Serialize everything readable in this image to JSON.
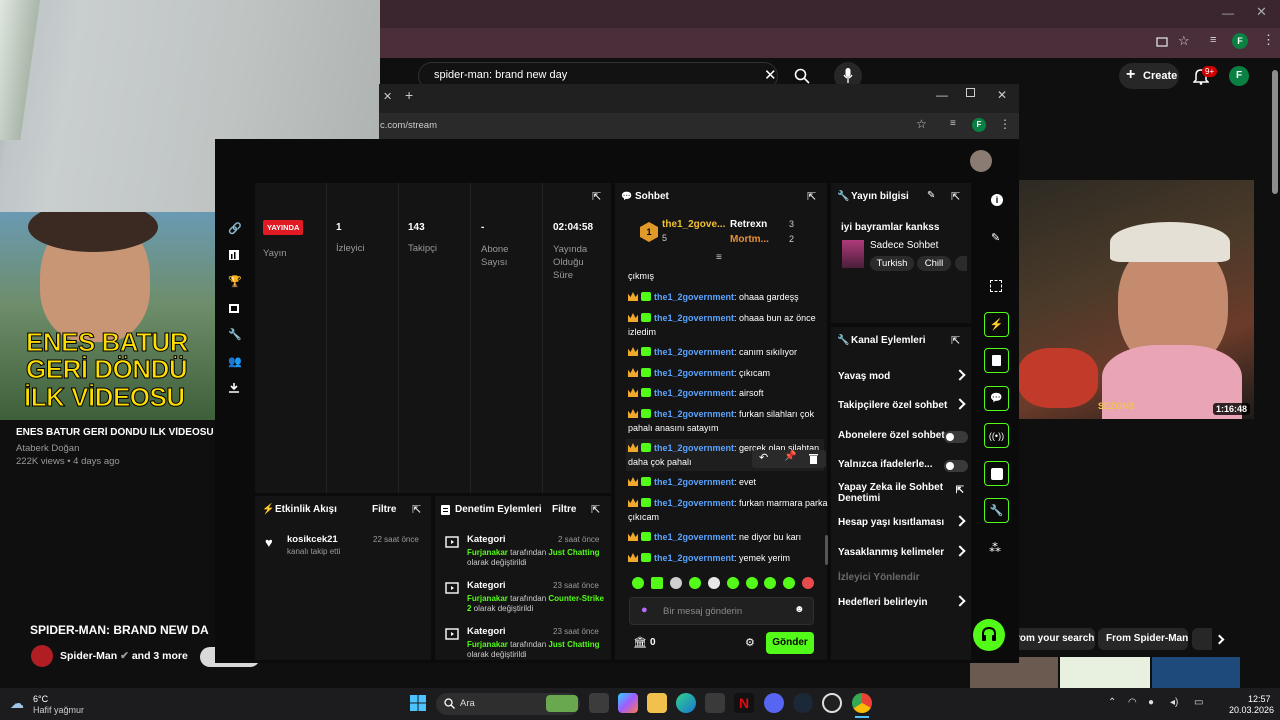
{
  "youtube": {
    "search_query": "spider-man: brand new day",
    "create_label": "Create",
    "notif_badge": "9+",
    "avatar": "F",
    "video1": {
      "title": "ENES BATUR GERİ DÖNDÜ İLK VİDEOSU",
      "channel": "Ataberk Doğan",
      "meta": "222K views • 4 days ago",
      "thumb_text": [
        "ENES BATUR",
        "GERİ DÖNDÜ",
        "İLK VİDEOSU"
      ]
    },
    "video2": {
      "duration": "1:16:48",
      "thumb_text": "SEZON3"
    },
    "section": {
      "title": "SPIDER-MAN: BRAND NEW DA",
      "channels": "Spider-Man",
      "more": "and 3 more"
    },
    "chips": [
      "rom your search",
      "From Spider-Man"
    ]
  },
  "kick": {
    "url": "c.com/stream",
    "avatar": "F",
    "stats": [
      {
        "value": "YAYINDA",
        "label": "Yayın"
      },
      {
        "value": "1",
        "label": "İzleyici"
      },
      {
        "value": "143",
        "label": "Takipçi"
      },
      {
        "value": "-",
        "label": "Abone Sayısı"
      },
      {
        "value": "02:04:58",
        "label": "Yayında Olduğu Süre"
      }
    ],
    "activity": {
      "title": "Etkinlik Akışı",
      "filter": "Filtre",
      "items": [
        {
          "user": "kosikcek21",
          "text": "kanalı takip etti",
          "time": "22 saat önce"
        }
      ]
    },
    "moderation": {
      "title": "Denetim Eylemleri",
      "filter": "Filtre",
      "items": [
        {
          "title": "Kategori",
          "time": "2 saat önce",
          "actor": "Furjanakar",
          "mid": " tarafından ",
          "target": "Just Chatting",
          "end": " olarak değiştirildi"
        },
        {
          "title": "Kategori",
          "time": "23 saat önce",
          "actor": "Furjanakar",
          "mid": " tarafından ",
          "target": "Counter-Strike 2",
          "end": " olarak değiştirildi"
        },
        {
          "title": "Kategori",
          "time": "23 saat önce",
          "actor": "Furjanakar",
          "mid": " tarafından ",
          "target": "Just Chatting",
          "end": " olarak değiştirildi"
        }
      ]
    },
    "chat": {
      "title": "Sohbet",
      "leader1": "the1_2gove...",
      "leader1_count": "5",
      "leader2": "Retrexn",
      "leader2_count": "3",
      "leader3": "Mortm...",
      "leader3_count": "2",
      "rank": "1",
      "top_partial": "çıkmış",
      "messages": [
        {
          "user": "the1_2government",
          "text": ": ohaaa gardeşş"
        },
        {
          "user": "the1_2government",
          "text": ": ohaaa bun az önce izledim"
        },
        {
          "user": "the1_2government",
          "text": ": canım sıkılıyor"
        },
        {
          "user": "the1_2government",
          "text": ": çıkıcam"
        },
        {
          "user": "the1_2government",
          "text": ": airsoft"
        },
        {
          "user": "the1_2government",
          "text": ": furkan silahları çok pahalı anasını satayım"
        },
        {
          "user": "the1_2government",
          "text": ": gerçek olan silahtan daha çok pahalı"
        },
        {
          "user": "the1_2government",
          "text": ": evet"
        },
        {
          "user": "the1_2government",
          "text": ": furkan marmara parka çıkıcam"
        },
        {
          "user": "the1_2government",
          "text": ": ne diyor bu karı"
        },
        {
          "user": "the1_2government",
          "text": ": yemek yerim"
        }
      ],
      "placeholder": "Bir mesaj gönderin",
      "points": "0",
      "send": "Gönder"
    },
    "info": {
      "title": "Yayın bilgisi",
      "stream_title": "iyi bayramlar kankss",
      "category": "Sadece Sohbet",
      "tags": [
        "Turkish",
        "Chill"
      ]
    },
    "actions": {
      "title": "Kanal Eylemleri",
      "items": [
        "Yavaş mod",
        "Takipçilere özel sohbet",
        "Abonelere özel sohbet",
        "Yalnızca ifadelerle...",
        "Yapay Zeka ile Sohbet Denetimi",
        "Hesap yaşı kısıtlaması",
        "Yasaklanmış kelimeler",
        "İzleyici Yönlendir",
        "Hedefleri belirleyin"
      ]
    }
  },
  "taskbar": {
    "temp": "6°C",
    "weather": "Hafif yağmur",
    "search": "Ara",
    "time": "12:57",
    "date": "20.03.2026"
  },
  "colors": {
    "accent": "#53fc18",
    "live": "#e01b24",
    "chat_user": "#5aa3ff"
  }
}
